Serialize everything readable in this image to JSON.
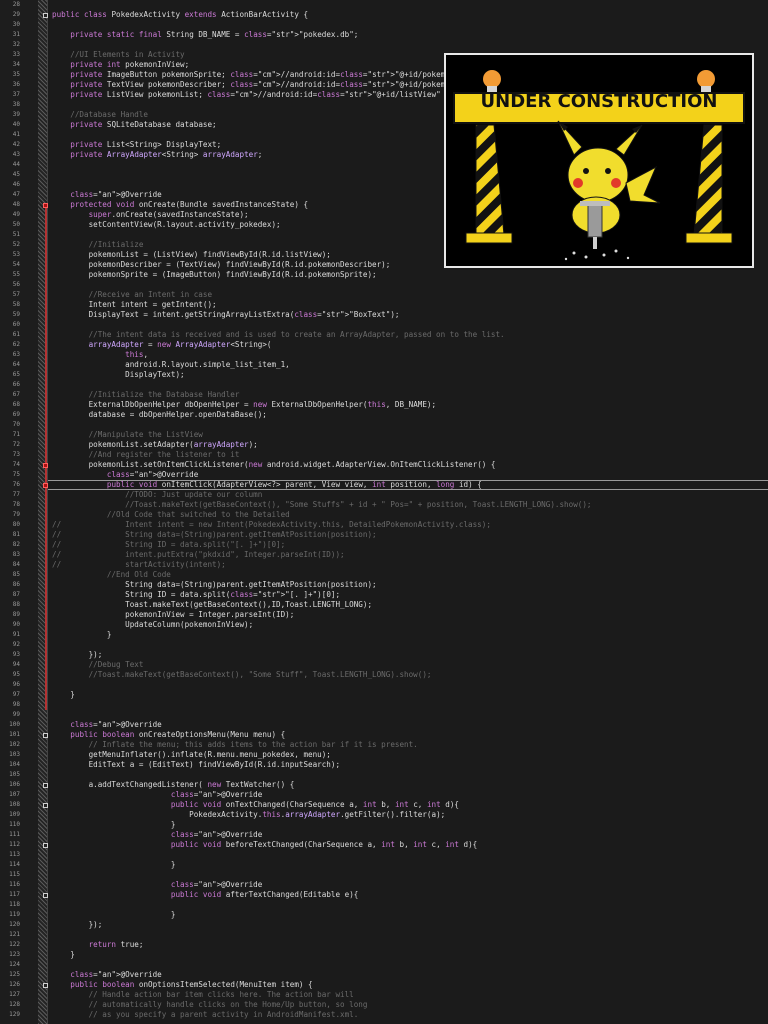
{
  "editor": {
    "language": "Java",
    "theme": "dark",
    "current_line": 76
  },
  "image_overlay": {
    "banner_text": "UNDER CONSTRUCTION",
    "colors": {
      "tape_yellow": "#f3d21a",
      "tape_black": "#111111",
      "lamp_orange": "#f29b35",
      "pikachu": "#f1dd2d"
    }
  },
  "lines": [
    {
      "n": "28",
      "t": ""
    },
    {
      "n": "29",
      "t": "public class PokedexActivity extends ActionBarActivity {",
      "f": true
    },
    {
      "n": "30",
      "t": ""
    },
    {
      "n": "31",
      "t": "    private static final String DB_NAME = \"pokedex.db\";"
    },
    {
      "n": "32",
      "t": ""
    },
    {
      "n": "33",
      "t": "    //UI Elements in Activity",
      "c": true
    },
    {
      "n": "34",
      "t": "    private int pokemonInView;"
    },
    {
      "n": "35",
      "t": "    private ImageButton pokemonSprite; //android:id=\"@+id/pokemonSprite\""
    },
    {
      "n": "36",
      "t": "    private TextView pokemonDescriber; //android:id=\"@+id/pokemonDescriber\""
    },
    {
      "n": "37",
      "t": "    private ListView pokemonList; //android:id=\"@+id/listView\""
    },
    {
      "n": "38",
      "t": ""
    },
    {
      "n": "39",
      "t": "    //Database Handle",
      "c": true
    },
    {
      "n": "40",
      "t": "    private SQLiteDatabase database;"
    },
    {
      "n": "41",
      "t": ""
    },
    {
      "n": "42",
      "t": "    private List<String> DisplayText;"
    },
    {
      "n": "43",
      "t": "    private ArrayAdapter<String> arrayAdapter;"
    },
    {
      "n": "44",
      "t": ""
    },
    {
      "n": "45",
      "t": ""
    },
    {
      "n": "46",
      "t": ""
    },
    {
      "n": "47",
      "t": "    @Override"
    },
    {
      "n": "48",
      "t": "    protected void onCreate(Bundle savedInstanceState) {",
      "f": true,
      "bp": true
    },
    {
      "n": "49",
      "t": "        super.onCreate(savedInstanceState);"
    },
    {
      "n": "50",
      "t": "        setContentView(R.layout.activity_pokedex);"
    },
    {
      "n": "51",
      "t": ""
    },
    {
      "n": "52",
      "t": "        //Initialize",
      "c": true
    },
    {
      "n": "53",
      "t": "        pokemonList = (ListView) findViewById(R.id.listView);"
    },
    {
      "n": "54",
      "t": "        pokemonDescriber = (TextView) findViewById(R.id.pokemonDescriber);"
    },
    {
      "n": "55",
      "t": "        pokemonSprite = (ImageButton) findViewById(R.id.pokemonSprite);"
    },
    {
      "n": "56",
      "t": ""
    },
    {
      "n": "57",
      "t": "        //Receive an Intent in case",
      "c": true
    },
    {
      "n": "58",
      "t": "        Intent intent = getIntent();"
    },
    {
      "n": "59",
      "t": "        DisplayText = intent.getStringArrayListExtra(\"BoxText\");"
    },
    {
      "n": "60",
      "t": ""
    },
    {
      "n": "61",
      "t": "        //The intent data is received and is used to create an ArrayAdapter, passed on to the list.",
      "c": true
    },
    {
      "n": "62",
      "t": "        arrayAdapter = new ArrayAdapter<String>("
    },
    {
      "n": "63",
      "t": "                this,"
    },
    {
      "n": "64",
      "t": "                android.R.layout.simple_list_item_1,"
    },
    {
      "n": "65",
      "t": "                DisplayText);"
    },
    {
      "n": "66",
      "t": ""
    },
    {
      "n": "67",
      "t": "        //Initialize the Database Handler",
      "c": true
    },
    {
      "n": "68",
      "t": "        ExternalDbOpenHelper dbOpenHelper = new ExternalDbOpenHelper(this, DB_NAME);"
    },
    {
      "n": "69",
      "t": "        database = dbOpenHelper.openDataBase();"
    },
    {
      "n": "70",
      "t": ""
    },
    {
      "n": "71",
      "t": "        //Manipulate the ListView",
      "c": true
    },
    {
      "n": "72",
      "t": "        pokemonList.setAdapter(arrayAdapter);"
    },
    {
      "n": "73",
      "t": "        //And register the listener to it",
      "c": true
    },
    {
      "n": "74",
      "t": "        pokemonList.setOnItemClickListener(new android.widget.AdapterView.OnItemClickListener() {",
      "f": true,
      "bp": true
    },
    {
      "n": "75",
      "t": "            @Override"
    },
    {
      "n": "76",
      "t": "            public void onItemClick(AdapterView<?> parent, View view, int position, long id) {",
      "f": true,
      "bp": true
    },
    {
      "n": "77",
      "t": "                //TODO: Just update our column",
      "c": true
    },
    {
      "n": "78",
      "t": "                //Toast.makeText(getBaseContext(), \"Some Stuffs\" + id + \" Pos=\" + position, Toast.LENGTH_LONG).show();",
      "c": true
    },
    {
      "n": "79",
      "t": "            //Old Code that switched to the Detailed",
      "c": true
    },
    {
      "n": "80",
      "t": "//              Intent intent = new Intent(PokedexActivity.this, DetailedPokemonActivity.class);",
      "c": true
    },
    {
      "n": "81",
      "t": "//              String data=(String)parent.getItemAtPosition(position);",
      "c": true
    },
    {
      "n": "82",
      "t": "//              String ID = data.split(\"[. ]+\")[0];",
      "c": true
    },
    {
      "n": "83",
      "t": "//              intent.putExtra(\"pkdxid\", Integer.parseInt(ID));",
      "c": true
    },
    {
      "n": "84",
      "t": "//              startActivity(intent);",
      "c": true
    },
    {
      "n": "85",
      "t": "            //End Old Code",
      "c": true
    },
    {
      "n": "86",
      "t": "                String data=(String)parent.getItemAtPosition(position);"
    },
    {
      "n": "87",
      "t": "                String ID = data.split(\"[. ]+\")[0];"
    },
    {
      "n": "88",
      "t": "                Toast.makeText(getBaseContext(),ID,Toast.LENGTH_LONG);"
    },
    {
      "n": "89",
      "t": "                pokemonInView = Integer.parseInt(ID);"
    },
    {
      "n": "90",
      "t": "                UpdateColumn(pokemonInView);"
    },
    {
      "n": "91",
      "t": "            }"
    },
    {
      "n": "92",
      "t": ""
    },
    {
      "n": "93",
      "t": "        });"
    },
    {
      "n": "94",
      "t": "        //Debug Text",
      "c": true
    },
    {
      "n": "95",
      "t": "        //Toast.makeText(getBaseContext(), \"Some Stuff\", Toast.LENGTH_LONG).show();",
      "c": true
    },
    {
      "n": "96",
      "t": ""
    },
    {
      "n": "97",
      "t": "    }"
    },
    {
      "n": "98",
      "t": ""
    },
    {
      "n": "99",
      "t": ""
    },
    {
      "n": "100",
      "t": "    @Override"
    },
    {
      "n": "101",
      "t": "    public boolean onCreateOptionsMenu(Menu menu) {",
      "f": true
    },
    {
      "n": "102",
      "t": "        // Inflate the menu; this adds items to the action bar if it is present.",
      "c": true
    },
    {
      "n": "103",
      "t": "        getMenuInflater().inflate(R.menu.menu_pokedex, menu);"
    },
    {
      "n": "104",
      "t": "        EditText a = (EditText) findViewById(R.id.inputSearch);"
    },
    {
      "n": "105",
      "t": ""
    },
    {
      "n": "106",
      "t": "        a.addTextChangedListener( new TextWatcher() {",
      "f": true
    },
    {
      "n": "107",
      "t": "                          @Override"
    },
    {
      "n": "108",
      "t": "                          public void onTextChanged(CharSequence a, int b, int c, int d){",
      "f": true
    },
    {
      "n": "109",
      "t": "                              PokedexActivity.this.arrayAdapter.getFilter().filter(a);"
    },
    {
      "n": "110",
      "t": "                          }"
    },
    {
      "n": "111",
      "t": "                          @Override"
    },
    {
      "n": "112",
      "t": "                          public void beforeTextChanged(CharSequence a, int b, int c, int d){",
      "f": true
    },
    {
      "n": "113",
      "t": ""
    },
    {
      "n": "114",
      "t": "                          }"
    },
    {
      "n": "115",
      "t": ""
    },
    {
      "n": "116",
      "t": "                          @Override"
    },
    {
      "n": "117",
      "t": "                          public void afterTextChanged(Editable e){",
      "f": true
    },
    {
      "n": "118",
      "t": ""
    },
    {
      "n": "119",
      "t": "                          }"
    },
    {
      "n": "120",
      "t": "        });"
    },
    {
      "n": "121",
      "t": ""
    },
    {
      "n": "122",
      "t": "        return true;"
    },
    {
      "n": "123",
      "t": "    }"
    },
    {
      "n": "124",
      "t": ""
    },
    {
      "n": "125",
      "t": "    @Override"
    },
    {
      "n": "126",
      "t": "    public boolean onOptionsItemSelected(MenuItem item) {",
      "f": true
    },
    {
      "n": "127",
      "t": "        // Handle action bar item clicks here. The action bar will",
      "c": true
    },
    {
      "n": "128",
      "t": "        // automatically handle clicks on the Home/Up button, so long",
      "c": true
    },
    {
      "n": "129",
      "t": "        // as you specify a parent activity in AndroidManifest.xml.",
      "c": true
    }
  ]
}
